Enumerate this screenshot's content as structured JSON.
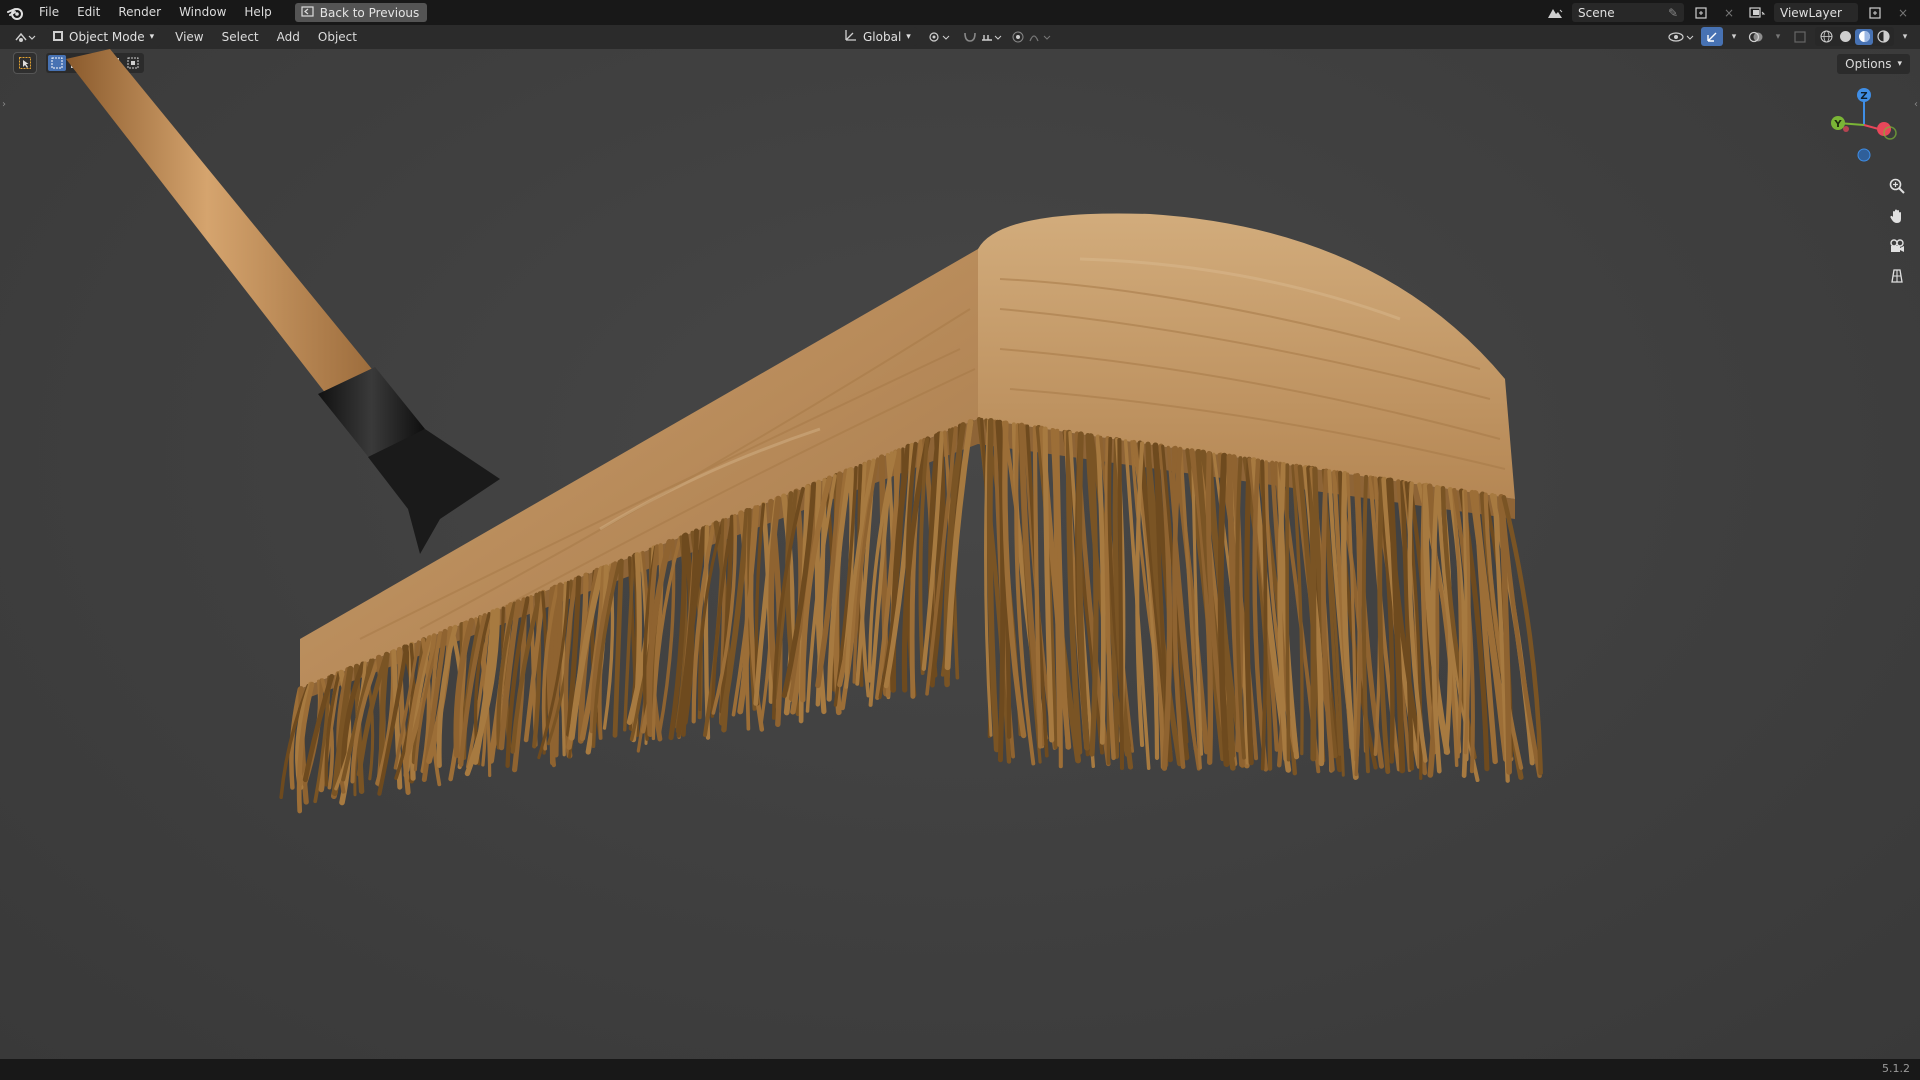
{
  "topbar": {
    "menus": [
      "File",
      "Edit",
      "Render",
      "Window",
      "Help"
    ],
    "back_button": "Back to Previous",
    "scene": "Scene",
    "view_layer": "ViewLayer"
  },
  "header": {
    "mode": "Object Mode",
    "menus": [
      "View",
      "Select",
      "Add",
      "Object"
    ],
    "transform_orientation": "Global"
  },
  "viewport": {
    "options_label": "Options",
    "gizmo_axes": {
      "x": "X",
      "y": "Y",
      "z": "Z"
    }
  },
  "statusbar": {
    "version": "5.1.2"
  },
  "colors": {
    "accent_blue": "#4772b3",
    "axis_x": "#e8475a",
    "axis_y": "#7ab536",
    "axis_z": "#3f8ee6",
    "wood": "#c9a06e",
    "bristle": "#8a6530"
  },
  "icons": [
    "blender-logo-icon",
    "back-icon",
    "editor-type-icon",
    "object-mode-icon",
    "orientation-icon",
    "pivot-icon",
    "snap-icon",
    "proportional-icon",
    "view-object-types-icon",
    "gizmo-icon",
    "overlay-icon",
    "xray-icon",
    "wireframe-shading-icon",
    "solid-shading-icon",
    "material-shading-icon",
    "rendered-shading-icon",
    "scene-icon",
    "view-layer-icon",
    "zoom-icon",
    "pan-hand-icon",
    "camera-icon",
    "ortho-grid-icon",
    "select-tool-icon"
  ]
}
